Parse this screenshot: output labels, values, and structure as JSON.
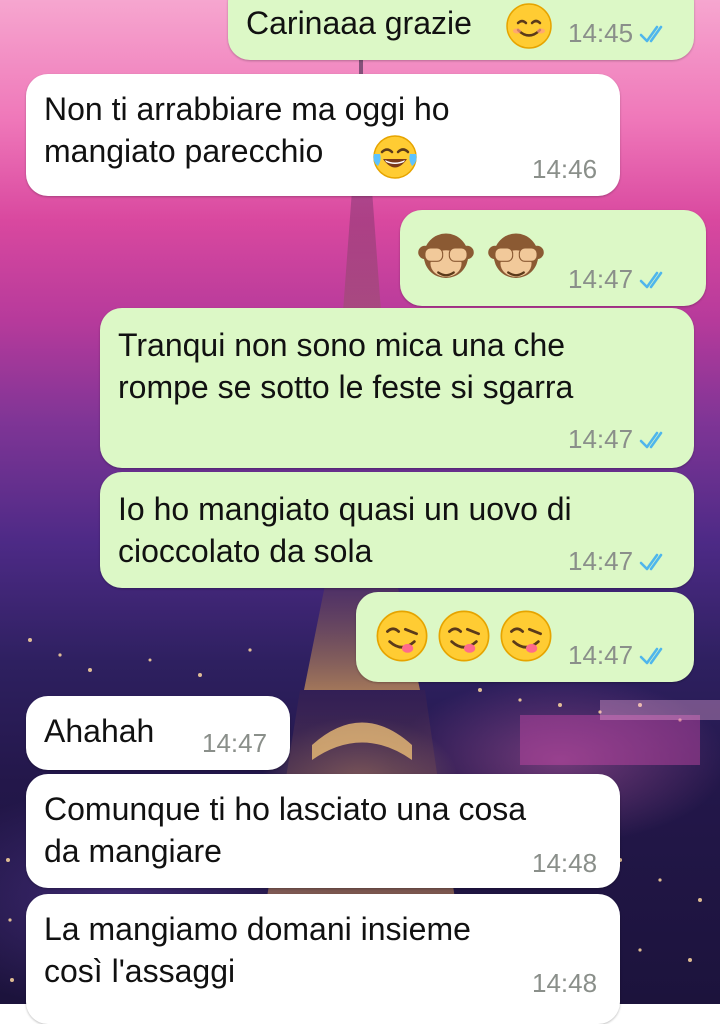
{
  "chat": {
    "messages": [
      {
        "id": "m1",
        "direction": "out",
        "text": "Carinaaa grazie",
        "emoji": [
          "smiling-face"
        ],
        "time": "14:45",
        "status": "read"
      },
      {
        "id": "m2",
        "direction": "in",
        "text": "Non ti arrabbiare ma oggi ho\nmangiato parecchio",
        "emoji": [
          "face-with-tears-of-joy"
        ],
        "time": "14:46"
      },
      {
        "id": "m3",
        "direction": "out",
        "text": "",
        "emoji": [
          "see-no-evil-monkey",
          "see-no-evil-monkey"
        ],
        "time": "14:47",
        "status": "read"
      },
      {
        "id": "m4",
        "direction": "out",
        "text": "Tranqui non sono mica una che\nrompe se sotto le feste si sgarra",
        "emoji": [],
        "time": "14:47",
        "status": "read"
      },
      {
        "id": "m5",
        "direction": "out",
        "text": "Io ho mangiato quasi un uovo di\ncioccolato da sola",
        "emoji": [],
        "time": "14:47",
        "status": "read"
      },
      {
        "id": "m6",
        "direction": "out",
        "text": "",
        "emoji": [
          "face-savoring-food",
          "face-savoring-food",
          "face-savoring-food"
        ],
        "time": "14:47",
        "status": "read"
      },
      {
        "id": "m7",
        "direction": "in",
        "text": "Ahahah",
        "emoji": [],
        "time": "14:47"
      },
      {
        "id": "m8",
        "direction": "in",
        "text": "Comunque ti ho lasciato una cosa\nda mangiare",
        "emoji": [],
        "time": "14:48"
      },
      {
        "id": "m9",
        "direction": "in",
        "text": "La mangiamo domani insieme\ncosì l'assaggi",
        "emoji": [],
        "time": "14:48"
      }
    ]
  },
  "colors": {
    "outgoing_bubble": "#dcf8c6",
    "incoming_bubble": "#ffffff",
    "read_ticks": "#4fb6ec",
    "timestamp": "#8a8f8a"
  }
}
